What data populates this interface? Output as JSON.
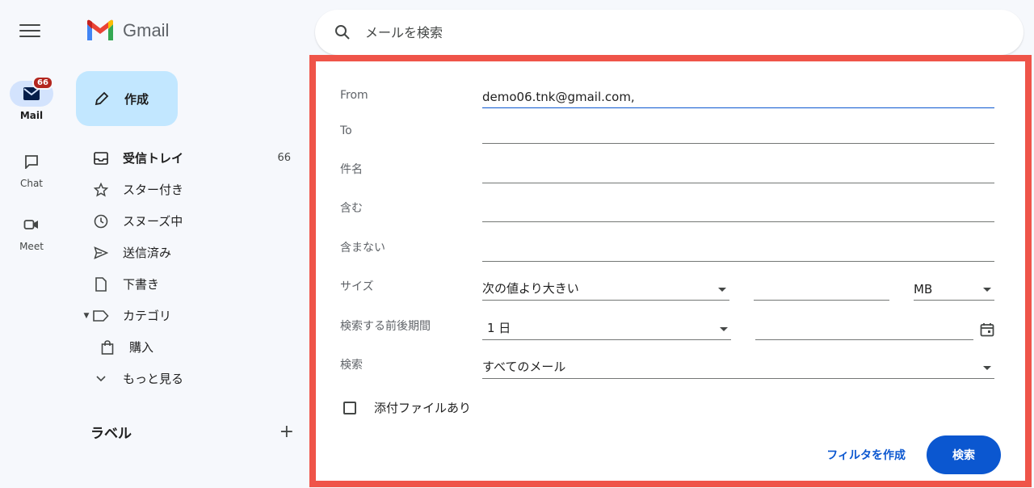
{
  "app": {
    "name": "Gmail"
  },
  "rail": {
    "items": [
      {
        "label": "Mail",
        "badge": "66",
        "icon": "mail-icon",
        "active": true
      },
      {
        "label": "Chat",
        "icon": "chat-icon"
      },
      {
        "label": "Meet",
        "icon": "video-icon"
      }
    ]
  },
  "compose": {
    "label": "作成"
  },
  "nav": {
    "items": [
      {
        "label": "受信トレイ",
        "count": "66",
        "icon": "inbox-icon"
      },
      {
        "label": "スター付き",
        "icon": "star-icon"
      },
      {
        "label": "スヌーズ中",
        "icon": "clock-icon"
      },
      {
        "label": "送信済み",
        "icon": "send-icon"
      },
      {
        "label": "下書き",
        "icon": "draft-icon"
      },
      {
        "label": "カテゴリ",
        "icon": "label-icon"
      },
      {
        "label": "購入",
        "icon": "shopping-bag-icon"
      },
      {
        "label": "もっと見る",
        "icon": "chevron-down-icon"
      }
    ],
    "labels_title": "ラベル"
  },
  "search": {
    "placeholder": "メールを検索"
  },
  "advanced": {
    "from_label": "From",
    "from_value": "demo06.tnk@gmail.com,",
    "to_label": "To",
    "subject_label": "件名",
    "has_label": "含む",
    "not_label": "含まない",
    "size_label": "サイズ",
    "size_op": "次の値より大きい",
    "size_unit": "MB",
    "date_label": "検索する前後期間",
    "date_range": "1 日",
    "search_label": "検索",
    "search_scope": "すべてのメール",
    "attachment_label": "添付ファイルあり",
    "filter_button": "フィルタを作成",
    "search_button": "検索"
  },
  "colors": {
    "accent": "#0b57d0",
    "highlight_border": "#ef5449",
    "compose_bg": "#c2e7ff"
  }
}
